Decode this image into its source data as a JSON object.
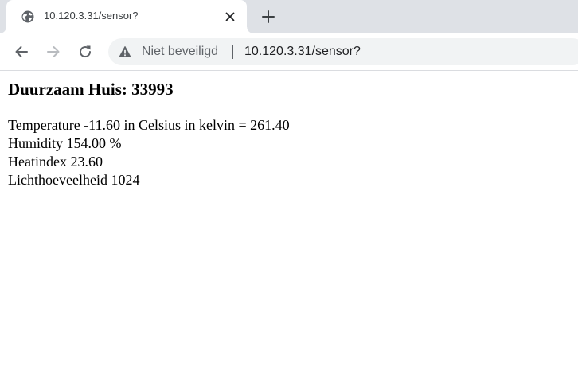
{
  "browser": {
    "tab": {
      "title": "10.120.3.31/sensor?",
      "favicon": "globe-icon"
    },
    "toolbar": {
      "back_icon": "back-arrow-icon",
      "forward_icon": "forward-arrow-icon",
      "reload_icon": "reload-icon",
      "security_icon": "warning-icon",
      "security_label": "Niet beveiligd",
      "url": "10.120.3.31/sensor?"
    },
    "colors": {
      "tabstrip_bg": "#dee1e6",
      "omnibox_bg": "#f1f3f4",
      "icon_color": "#5f6368"
    }
  },
  "page": {
    "heading": "Duurzaam Huis: 33993",
    "readings": [
      "Temperature -11.60 in Celsius in kelvin = 261.40",
      "Humidity 154.00 %",
      "Heatindex 23.60",
      "Lichthoeveelheid 1024"
    ]
  }
}
